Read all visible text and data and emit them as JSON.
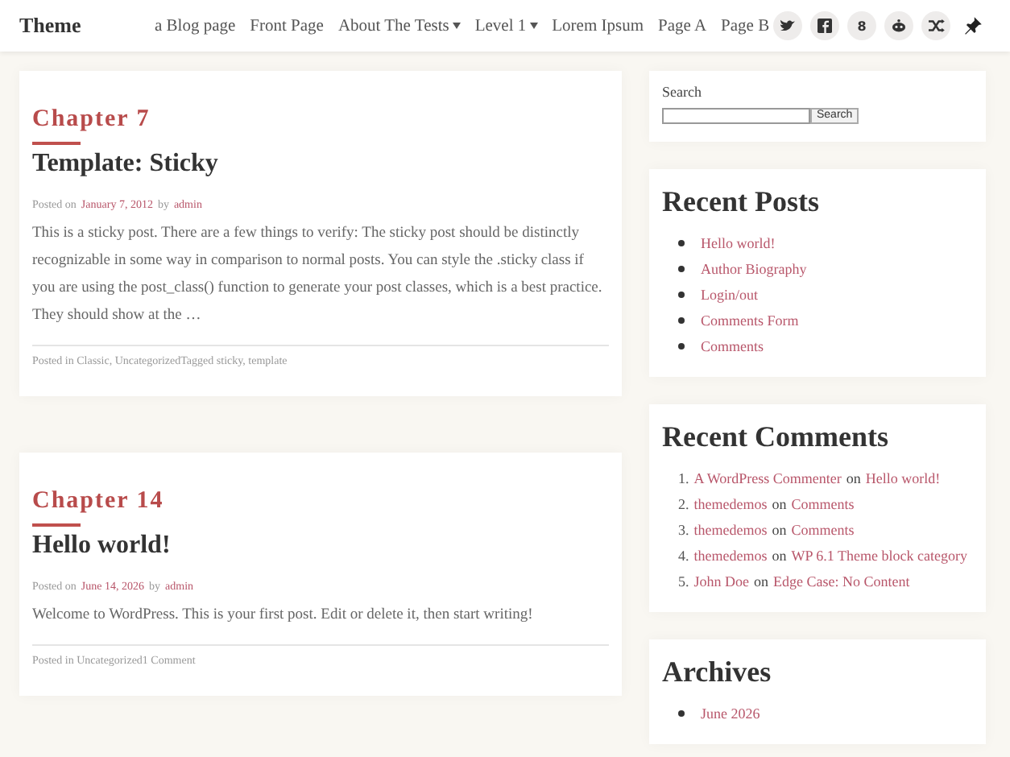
{
  "header": {
    "site_title": "Theme",
    "menu": [
      {
        "label": "a Blog page",
        "has_submenu": false
      },
      {
        "label": "Front Page",
        "has_submenu": false
      },
      {
        "label": "About The Tests",
        "has_submenu": true
      },
      {
        "label": "Level 1",
        "has_submenu": true
      },
      {
        "label": "Lorem Ipsum",
        "has_submenu": false
      },
      {
        "label": "Page A",
        "has_submenu": false
      },
      {
        "label": "Page B",
        "has_submenu": false
      }
    ],
    "social": [
      {
        "kind": "bird"
      },
      {
        "kind": "facebook"
      },
      {
        "kind": "glyph",
        "glyph": "8"
      },
      {
        "kind": "robot"
      },
      {
        "kind": "shuffle"
      },
      {
        "kind": "pin"
      }
    ]
  },
  "posts": [
    {
      "chapter": "Chapter 7",
      "title": "Template: Sticky",
      "posted_on": "Posted on",
      "date": "January 7, 2012",
      "by": "by",
      "author": "admin",
      "excerpt": "This is a sticky post. There are a few things to verify: The sticky post should be distinctly recognizable in some way in comparison to normal posts. You can style the .sticky class if you are using the post_class() function to generate your post classes, which is a best practice. They should show at the …",
      "footer": "Posted in Classic, UncategorizedTagged sticky, template"
    },
    {
      "chapter": "Chapter 14",
      "title": "Hello world!",
      "posted_on": "Posted on",
      "date": "June 14, 2026",
      "by": "by",
      "author": "admin",
      "excerpt": "Welcome to WordPress. This is your first post. Edit or delete it, then start writing!",
      "footer": "Posted in Uncategorized1 Comment"
    }
  ],
  "sidebar": {
    "search": {
      "label": "Search",
      "button": "Search"
    },
    "recent_posts": {
      "title": "Recent Posts",
      "items": [
        "Hello world!",
        "Author Biography",
        "Login/out",
        "Comments Form",
        "Comments"
      ]
    },
    "recent_comments": {
      "title": "Recent Comments",
      "items": [
        {
          "number": "1.",
          "author": "A WordPress Commenter",
          "on": "on",
          "post": "Hello world!"
        },
        {
          "number": "2.",
          "author": "themedemos",
          "on": "on",
          "post": "Comments"
        },
        {
          "number": "3.",
          "author": "themedemos",
          "on": "on",
          "post": "Comments"
        },
        {
          "number": "4.",
          "author": "themedemos",
          "on": "on",
          "post": "WP 6.1 Theme block category"
        },
        {
          "number": "5.",
          "author": "John Doe",
          "on": "on",
          "post": "Edge Case: No Content"
        }
      ]
    },
    "archives": {
      "title": "Archives",
      "items": [
        "June 2026"
      ]
    }
  }
}
